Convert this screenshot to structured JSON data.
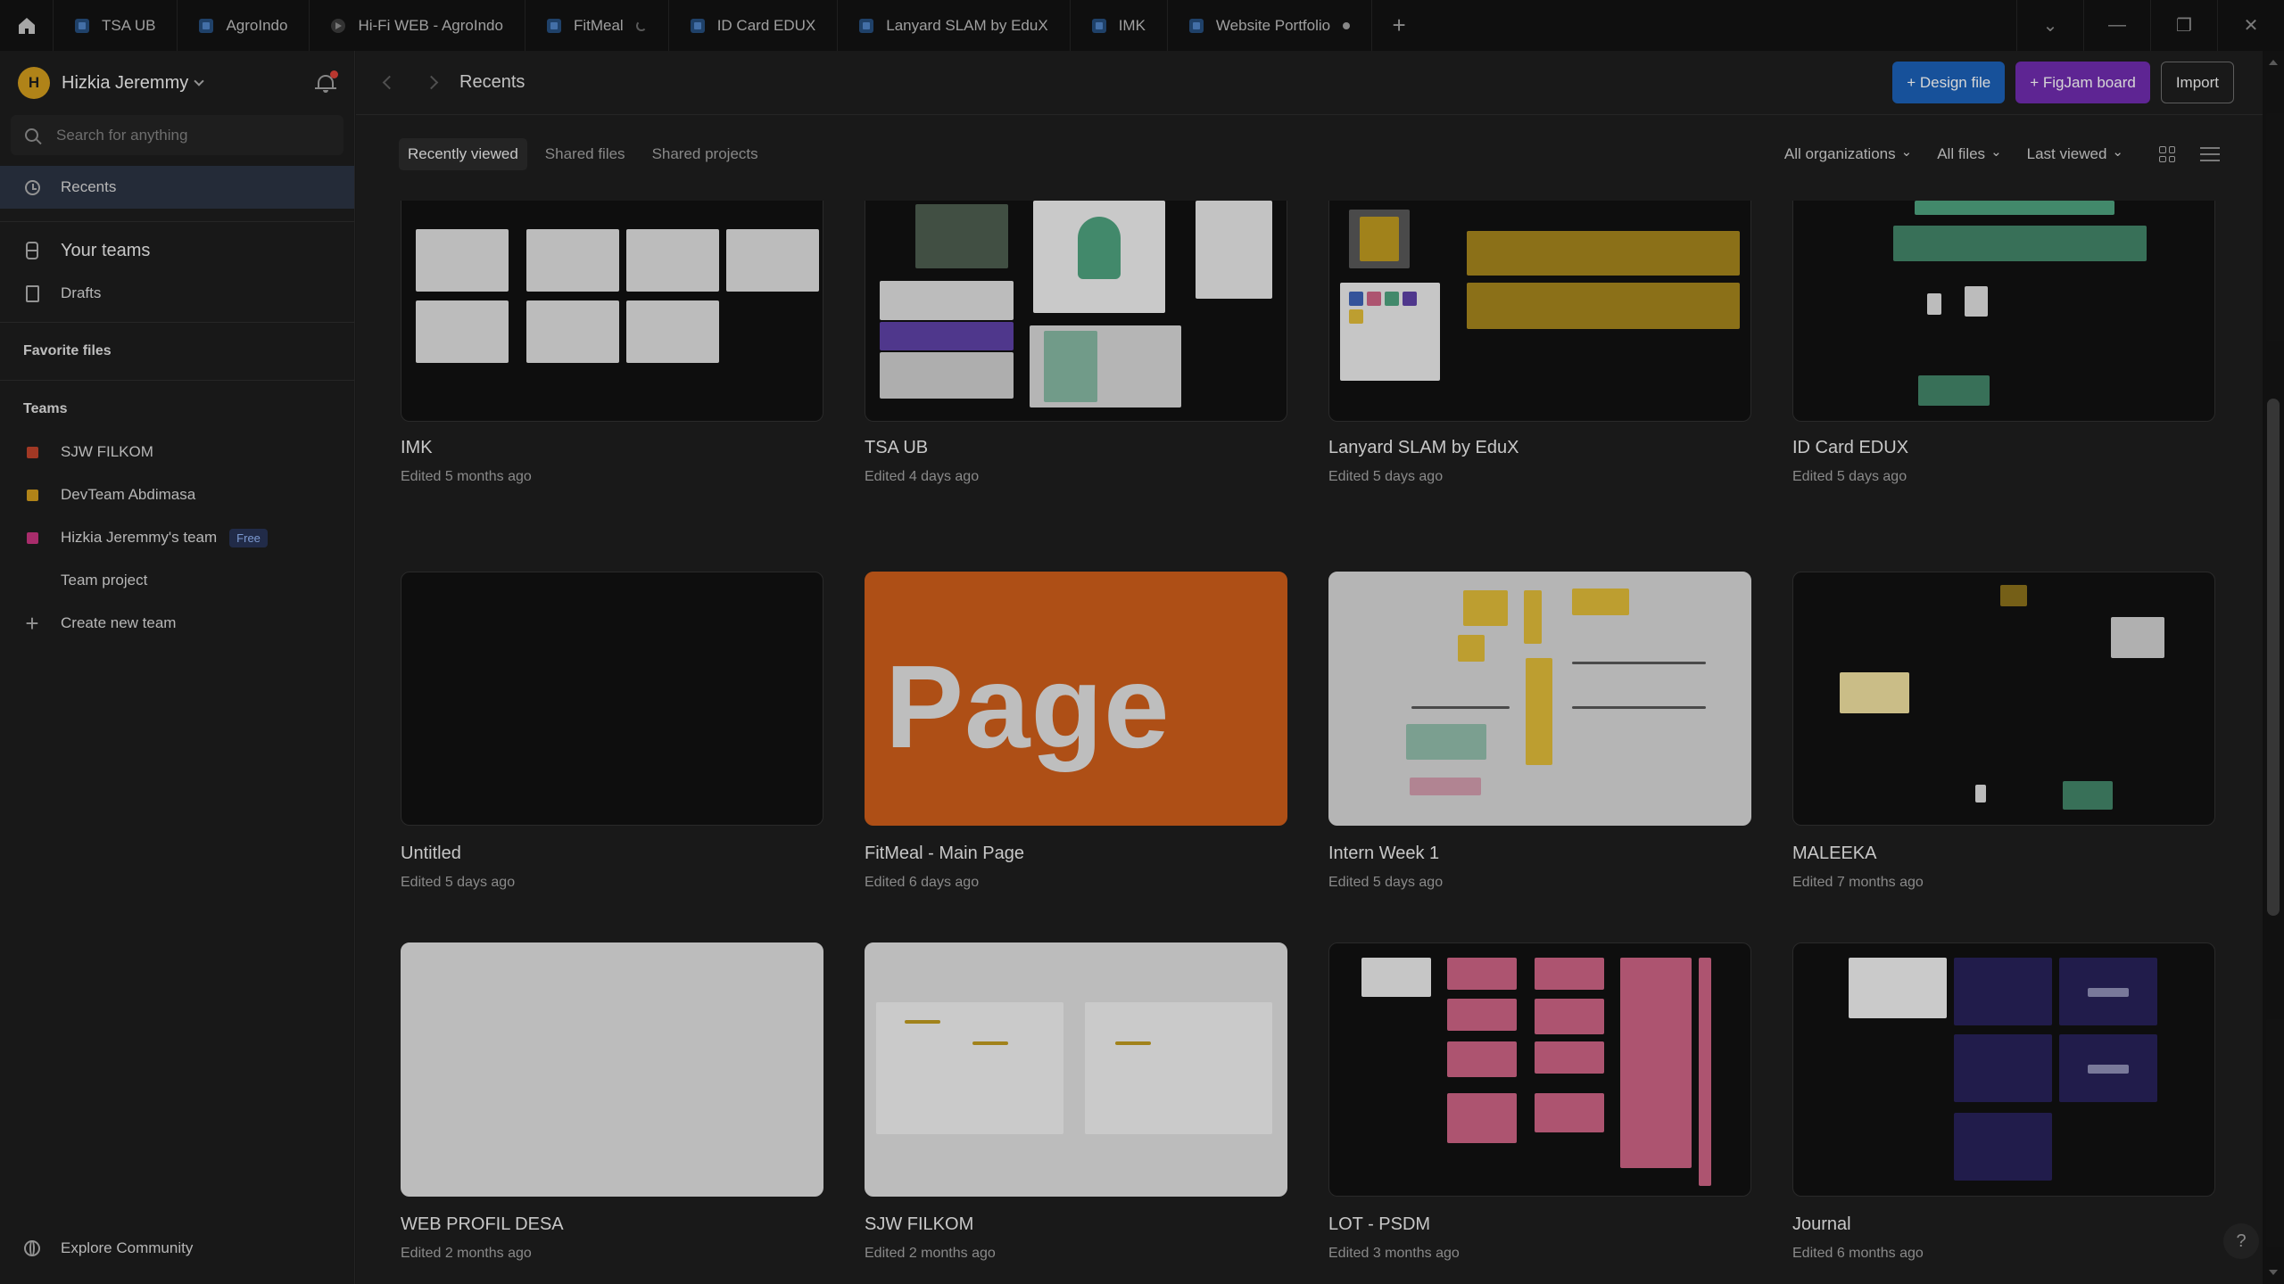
{
  "tabs": [
    {
      "label": "TSA UB",
      "kind": "design"
    },
    {
      "label": "AgroIndo",
      "kind": "design"
    },
    {
      "label": "Hi-Fi WEB - AgroIndo",
      "kind": "prototype"
    },
    {
      "label": "FitMeal",
      "kind": "design",
      "loading": true
    },
    {
      "label": "ID Card EDUX",
      "kind": "design"
    },
    {
      "label": "Lanyard SLAM by EduX",
      "kind": "design"
    },
    {
      "label": "IMK",
      "kind": "design"
    },
    {
      "label": "Website Portfolio",
      "kind": "design",
      "unsaved": true
    }
  ],
  "user": {
    "initial": "H",
    "name": "Hizkia Jeremmy",
    "avatar_color": "#c9961c"
  },
  "search": {
    "placeholder": "Search for anything"
  },
  "sidebar": {
    "recents": "Recents",
    "your_teams": "Your teams",
    "drafts": "Drafts",
    "favorite_files": "Favorite files",
    "teams_heading": "Teams",
    "teams": [
      {
        "name": "SJW FILKOM",
        "color": "#b8402a"
      },
      {
        "name": "DevTeam Abdimasa",
        "color": "#c9961c"
      },
      {
        "name": "Hizkia Jeremmy's team",
        "color": "#c0337a",
        "badge": "Free"
      },
      {
        "name": "Team project",
        "color": ""
      }
    ],
    "create_team": "Create new team",
    "explore": "Explore Community"
  },
  "header": {
    "title": "Recents",
    "design_file": "+ Design file",
    "figjam_board": "+ FigJam board",
    "import": "Import"
  },
  "filters": {
    "tabs": [
      "Recently viewed",
      "Shared files",
      "Shared projects"
    ],
    "organizations": "All organizations",
    "files": "All files",
    "sort": "Last viewed"
  },
  "files": [
    {
      "title": "IMK",
      "edited": "Edited 5 months ago"
    },
    {
      "title": "TSA UB",
      "edited": "Edited 4 days ago"
    },
    {
      "title": "Lanyard SLAM by EduX",
      "edited": "Edited 5 days ago"
    },
    {
      "title": "ID Card EDUX",
      "edited": "Edited 5 days ago"
    },
    {
      "title": "Untitled",
      "edited": "Edited 5 days ago"
    },
    {
      "title": "FitMeal - Main Page",
      "edited": "Edited 6 days ago",
      "thumb_text": "Page"
    },
    {
      "title": "Intern Week 1",
      "edited": "Edited 5 days ago"
    },
    {
      "title": "MALEEKA",
      "edited": "Edited 7 months ago"
    },
    {
      "title": "WEB PROFIL DESA",
      "edited": "Edited 2 months ago"
    },
    {
      "title": "SJW FILKOM",
      "edited": "Edited 2 months ago"
    },
    {
      "title": "LOT - PSDM",
      "edited": "Edited 3 months ago"
    },
    {
      "title": "Journal",
      "edited": "Edited 6 months ago"
    }
  ],
  "colors": {
    "accent_blue": "#1b5db0",
    "accent_purple": "#6b2ba8",
    "active_nav": "#2a3140"
  }
}
